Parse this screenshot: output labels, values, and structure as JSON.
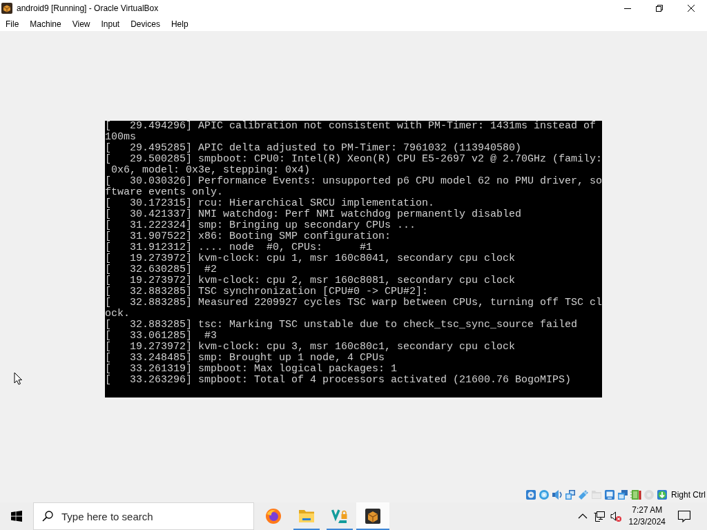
{
  "window": {
    "title": "android9 [Running] - Oracle VirtualBox"
  },
  "menu_bar": {
    "items": [
      "File",
      "Machine",
      "View",
      "Input",
      "Devices",
      "Help"
    ]
  },
  "console": {
    "lines": [
      "[   29.494296] APIC calibration not consistent with PM-Timer: 1431ms instead of",
      "100ms",
      "[   29.495285] APIC delta adjusted to PM-Timer: 7961032 (113940580)",
      "[   29.500285] smpboot: CPU0: Intel(R) Xeon(R) CPU E5-2697 v2 @ 2.70GHz (family:",
      " 0x6, model: 0x3e, stepping: 0x4)",
      "[   30.030326] Performance Events: unsupported p6 CPU model 62 no PMU driver, so",
      "ftware events only.",
      "[   30.172315] rcu: Hierarchical SRCU implementation.",
      "[   30.421337] NMI watchdog: Perf NMI watchdog permanently disabled",
      "[   31.222324] smp: Bringing up secondary CPUs ...",
      "[   31.907522] x86: Booting SMP configuration:",
      "[   31.912312] .... node  #0, CPUs:      #1",
      "[   19.273972] kvm-clock: cpu 1, msr 160c8041, secondary cpu clock",
      "[   32.630285]  #2",
      "[   19.273972] kvm-clock: cpu 2, msr 160c8081, secondary cpu clock",
      "[   32.883285] TSC synchronization [CPU#0 -> CPU#2]:",
      "[   32.883285] Measured 2209927 cycles TSC warp between CPUs, turning off TSC cl",
      "ock.",
      "[   32.883285] tsc: Marking TSC unstable due to check_tsc_sync_source failed",
      "[   33.061285]  #3",
      "[   19.273972] kvm-clock: cpu 3, msr 160c80c1, secondary cpu clock",
      "[   33.248485] smp: Brought up 1 node, 4 CPUs",
      "[   33.261319] smpboot: Max logical packages: 1",
      "[   33.263296] smpboot: Total of 4 processors activated (21600.76 BogoMIPS)"
    ]
  },
  "status_bar": {
    "indicators": [
      {
        "kind": "hard-disk",
        "disabled": false
      },
      {
        "kind": "optical-disc",
        "disabled": false
      },
      {
        "kind": "audio",
        "disabled": false
      },
      {
        "kind": "network",
        "disabled": false
      },
      {
        "kind": "usb",
        "disabled": false
      },
      {
        "kind": "shared-folders",
        "disabled": true
      },
      {
        "kind": "display",
        "disabled": false
      },
      {
        "kind": "recording",
        "disabled": false
      },
      {
        "kind": "cpu",
        "disabled": false
      },
      {
        "kind": "mouse",
        "disabled": true
      },
      {
        "kind": "keyboard",
        "disabled": false
      }
    ],
    "host_key": "Right Ctrl"
  },
  "taskbar": {
    "search": {
      "placeholder": "Type here to search"
    },
    "apps": [
      {
        "kind": "browser",
        "running": false,
        "selected": false
      },
      {
        "kind": "files",
        "running": true,
        "selected": false
      },
      {
        "kind": "chevron",
        "running": true,
        "selected": false
      },
      {
        "kind": "virtualbox",
        "running": true,
        "selected": true
      }
    ],
    "tray": {
      "volume_muted": true,
      "time": "7:27 AM",
      "date": "12/3/2024"
    }
  }
}
